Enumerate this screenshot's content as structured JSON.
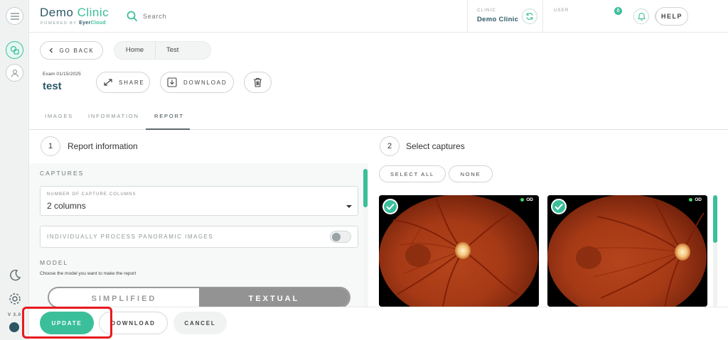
{
  "app": {
    "title_part1": "Demo",
    "title_part2": "Clinic",
    "powered_by": "POWERED BY",
    "powered_brand_1": "Eyer",
    "powered_brand_2": "Cloud",
    "version": "V 3.0"
  },
  "header": {
    "search_placeholder": "Search",
    "clinic_label": "CLINIC",
    "clinic_name": "Demo Clinic",
    "user_label": "USER",
    "notification_count": "0",
    "help_label": "HELP"
  },
  "toolbar": {
    "go_back_label": "GO BACK",
    "breadcrumbs": [
      "Home",
      "Test"
    ],
    "exam_date": "Exam 01/15/2025",
    "exam_name": "test",
    "share_label": "SHARE",
    "download_label": "DOWNLOAD"
  },
  "tabs": [
    {
      "label": "IMAGES",
      "active": false
    },
    {
      "label": "INFORMATION",
      "active": false
    },
    {
      "label": "REPORT",
      "active": true
    }
  ],
  "report_info": {
    "step_number": "1",
    "title": "Report information",
    "captures_section": "CAPTURES",
    "columns_field_label": "NUMBER OF CAPTURE COLUMNS",
    "columns_value": "2 columns",
    "panoramic_label": "INDIVIDUALLY PROCESS PANORAMIC IMAGES",
    "panoramic_enabled": false,
    "model_section": "MODEL",
    "model_description": "Choose the model you want to make the report",
    "model_options": [
      "SIMPLIFIED",
      "TEXTUAL"
    ],
    "model_selected": "TEXTUAL"
  },
  "select_captures": {
    "step_number": "2",
    "title": "Select captures",
    "select_all_label": "SELECT ALL",
    "none_label": "NONE",
    "captures": [
      {
        "eye": "OD",
        "selected": true
      },
      {
        "eye": "OD",
        "selected": true
      }
    ]
  },
  "footer": {
    "update_label": "UPDATE",
    "download_label": "DOWNLOAD",
    "cancel_label": "CANCEL"
  },
  "colors": {
    "accent": "#3bbf9b",
    "brand_dark": "#2f5969",
    "highlight": "#e8191f"
  }
}
